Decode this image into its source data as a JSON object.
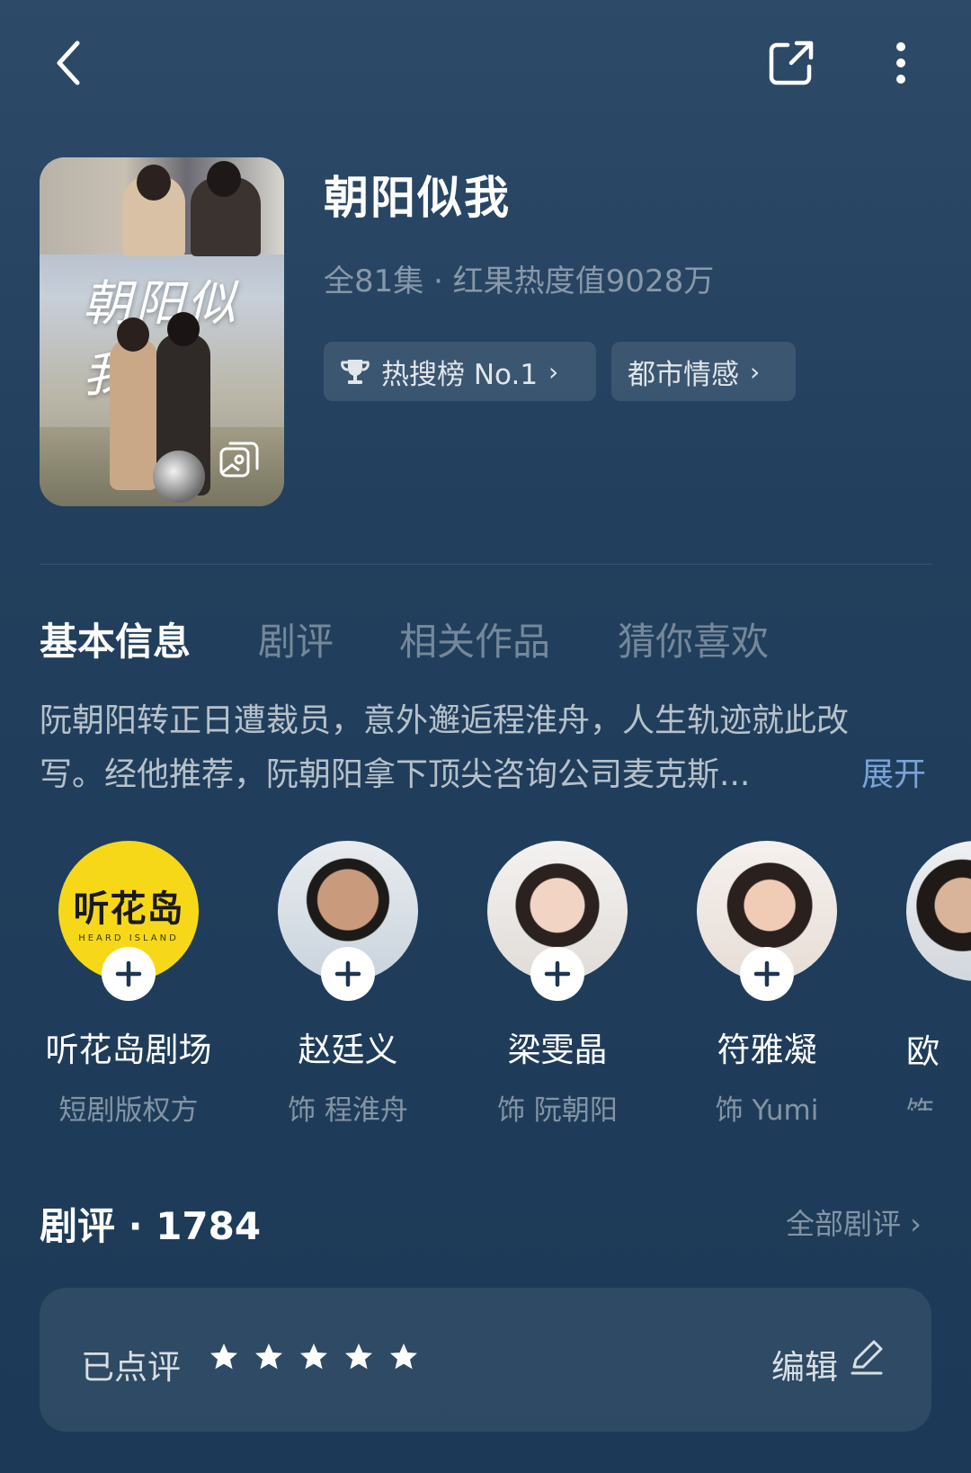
{
  "header": {
    "icons": [
      "back-icon",
      "share-icon",
      "more-icon"
    ]
  },
  "drama": {
    "title": "朝阳似我",
    "meta": "全81集 · 红果热度值9028万",
    "poster_title": "朝阳似我",
    "chips": [
      {
        "label": "热搜榜 No.1",
        "icon": "trophy-icon"
      },
      {
        "label": "都市情感"
      }
    ]
  },
  "tabs": [
    {
      "label": "基本信息",
      "active": true
    },
    {
      "label": "剧评",
      "active": false
    },
    {
      "label": "相关作品",
      "active": false
    },
    {
      "label": "猜你喜欢",
      "active": false
    }
  ],
  "synopsis": {
    "line1": "阮朝阳转正日遭裁员，意外邂逅程淮舟，人生轨迹就此改",
    "line2": "写。经他推荐，阮朝阳拿下顶尖咨询公司麦克斯...",
    "expand_label": "展开"
  },
  "cast": [
    {
      "name": "听花岛剧场",
      "role": "短剧版权方",
      "logo_text": "听花岛",
      "logo_sub": "HEARD ISLAND"
    },
    {
      "name": "赵廷义",
      "role": "饰 程淮舟"
    },
    {
      "name": "梁雯晶",
      "role": "饰 阮朝阳"
    },
    {
      "name": "符雅凝",
      "role": "饰 Yumi"
    },
    {
      "name": "欧",
      "role": "饰"
    }
  ],
  "reviews": {
    "title": "剧评 · 1784",
    "all_label": "全部剧评 ›",
    "reviewed_label": "已点评",
    "rating": 5,
    "rating_max": 5,
    "edit_label": "编辑"
  }
}
